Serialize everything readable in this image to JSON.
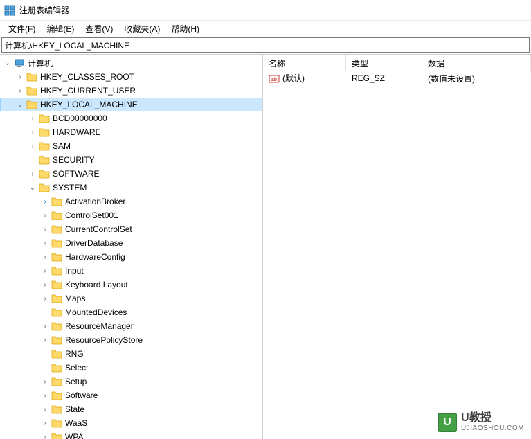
{
  "window": {
    "title": "注册表编辑器"
  },
  "menu": {
    "file": "文件(F)",
    "edit": "编辑(E)",
    "view": "查看(V)",
    "favorites": "收藏夹(A)",
    "help": "帮助(H)"
  },
  "address": "计算机\\HKEY_LOCAL_MACHINE",
  "tree": {
    "root": "计算机",
    "hives": [
      {
        "name": "HKEY_CLASSES_ROOT",
        "expanded": false
      },
      {
        "name": "HKEY_CURRENT_USER",
        "expanded": false
      },
      {
        "name": "HKEY_LOCAL_MACHINE",
        "expanded": true,
        "selected": true,
        "children": [
          {
            "name": "BCD00000000",
            "expandable": true
          },
          {
            "name": "HARDWARE",
            "expandable": true
          },
          {
            "name": "SAM",
            "expandable": true
          },
          {
            "name": "SECURITY",
            "expandable": false
          },
          {
            "name": "SOFTWARE",
            "expandable": true
          },
          {
            "name": "SYSTEM",
            "expandable": true,
            "expanded": true,
            "children": [
              {
                "name": "ActivationBroker",
                "expandable": true,
                "blue": true
              },
              {
                "name": "ControlSet001",
                "expandable": true
              },
              {
                "name": "CurrentControlSet",
                "expandable": true
              },
              {
                "name": "DriverDatabase",
                "expandable": true
              },
              {
                "name": "HardwareConfig",
                "expandable": true
              },
              {
                "name": "Input",
                "expandable": true
              },
              {
                "name": "Keyboard Layout",
                "expandable": true
              },
              {
                "name": "Maps",
                "expandable": true
              },
              {
                "name": "MountedDevices",
                "expandable": false
              },
              {
                "name": "ResourceManager",
                "expandable": true
              },
              {
                "name": "ResourcePolicyStore",
                "expandable": true
              },
              {
                "name": "RNG",
                "expandable": false
              },
              {
                "name": "Select",
                "expandable": false
              },
              {
                "name": "Setup",
                "expandable": true
              },
              {
                "name": "Software",
                "expandable": true
              },
              {
                "name": "State",
                "expandable": true
              },
              {
                "name": "WaaS",
                "expandable": true
              },
              {
                "name": "WPA",
                "expandable": true
              }
            ]
          }
        ]
      }
    ]
  },
  "list": {
    "headers": {
      "name": "名称",
      "type": "类型",
      "data": "数据"
    },
    "rows": [
      {
        "name": "(默认)",
        "type": "REG_SZ",
        "data": "(数值未设置)"
      }
    ]
  },
  "watermark": {
    "letter": "U",
    "title": "U教授",
    "url": "UJIAOSHOU.COM"
  }
}
